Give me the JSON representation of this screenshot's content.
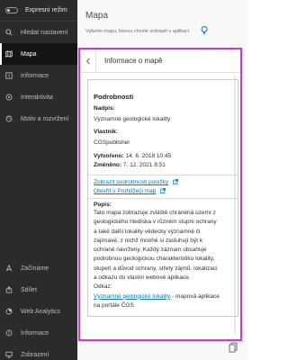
{
  "sidebar": {
    "express_label": "Expresní režim",
    "top_items": [
      {
        "label": "Hledat nastavení",
        "icon": "search-icon"
      },
      {
        "label": "Mapa",
        "icon": "map-icon",
        "active": true
      },
      {
        "label": "Informace",
        "icon": "info-icon"
      },
      {
        "label": "Interaktivita",
        "icon": "interactivity-icon"
      },
      {
        "label": "Motiv a rozvržení",
        "icon": "theme-icon"
      }
    ],
    "bottom_items": [
      {
        "label": "Začínáme",
        "icon": "start-icon"
      },
      {
        "label": "Sdílet",
        "icon": "share-icon"
      },
      {
        "label": "Web Analytics",
        "icon": "analytics-icon"
      },
      {
        "label": "Informace",
        "icon": "info-icon"
      },
      {
        "label": "Zobrazení",
        "icon": "display-icon"
      }
    ]
  },
  "main": {
    "title": "Mapa",
    "subtitle": "Vyberte mapu, kterou chcete zobrazit v aplikaci",
    "panel": {
      "title": "Informace o mapě",
      "details_heading": "Podrobnosti",
      "name_label": "Nadpis:",
      "name_value": "Významné geologické lokality",
      "owner_label": "Vlastník:",
      "owner_value": "CGSpublisher",
      "created_label": "Vytvořeno:",
      "created_value": " 14. 6. 2018 10:45",
      "modified_label": "Změněno:",
      "modified_value": " 7. 12. 2021 8:51",
      "show_details_link": "Zobrazit podrobnosti položky",
      "open_viewer_link": "Otevřít v Prohlížeči map",
      "description_label": "Popis:",
      "description_text": "Tato mapa zobrazuje zvláště chráněná území z geologického hlediska v různém stupni ochrany a také další lokality vědecky významné či zajímavé, z nichž mnohé si zasluhují být k ochraně navrženy. Každý záznam obsahuje podrobnou geologickou charakteristiku lokality, stupeň a důvod ochrany, střety zájmů, lokalizaci a odkazu do vlastní webové aplikace.",
      "links_label": "Odkaz:",
      "app_link": "Významné geologické lokality",
      "app_link_suffix": " - mapová aplikace na portále ČGS"
    }
  },
  "colors": {
    "sidebar_bg": "#2b2b2b",
    "active_bg": "#151515",
    "link": "#0079c1",
    "frame_highlight": "#d92ce4"
  }
}
